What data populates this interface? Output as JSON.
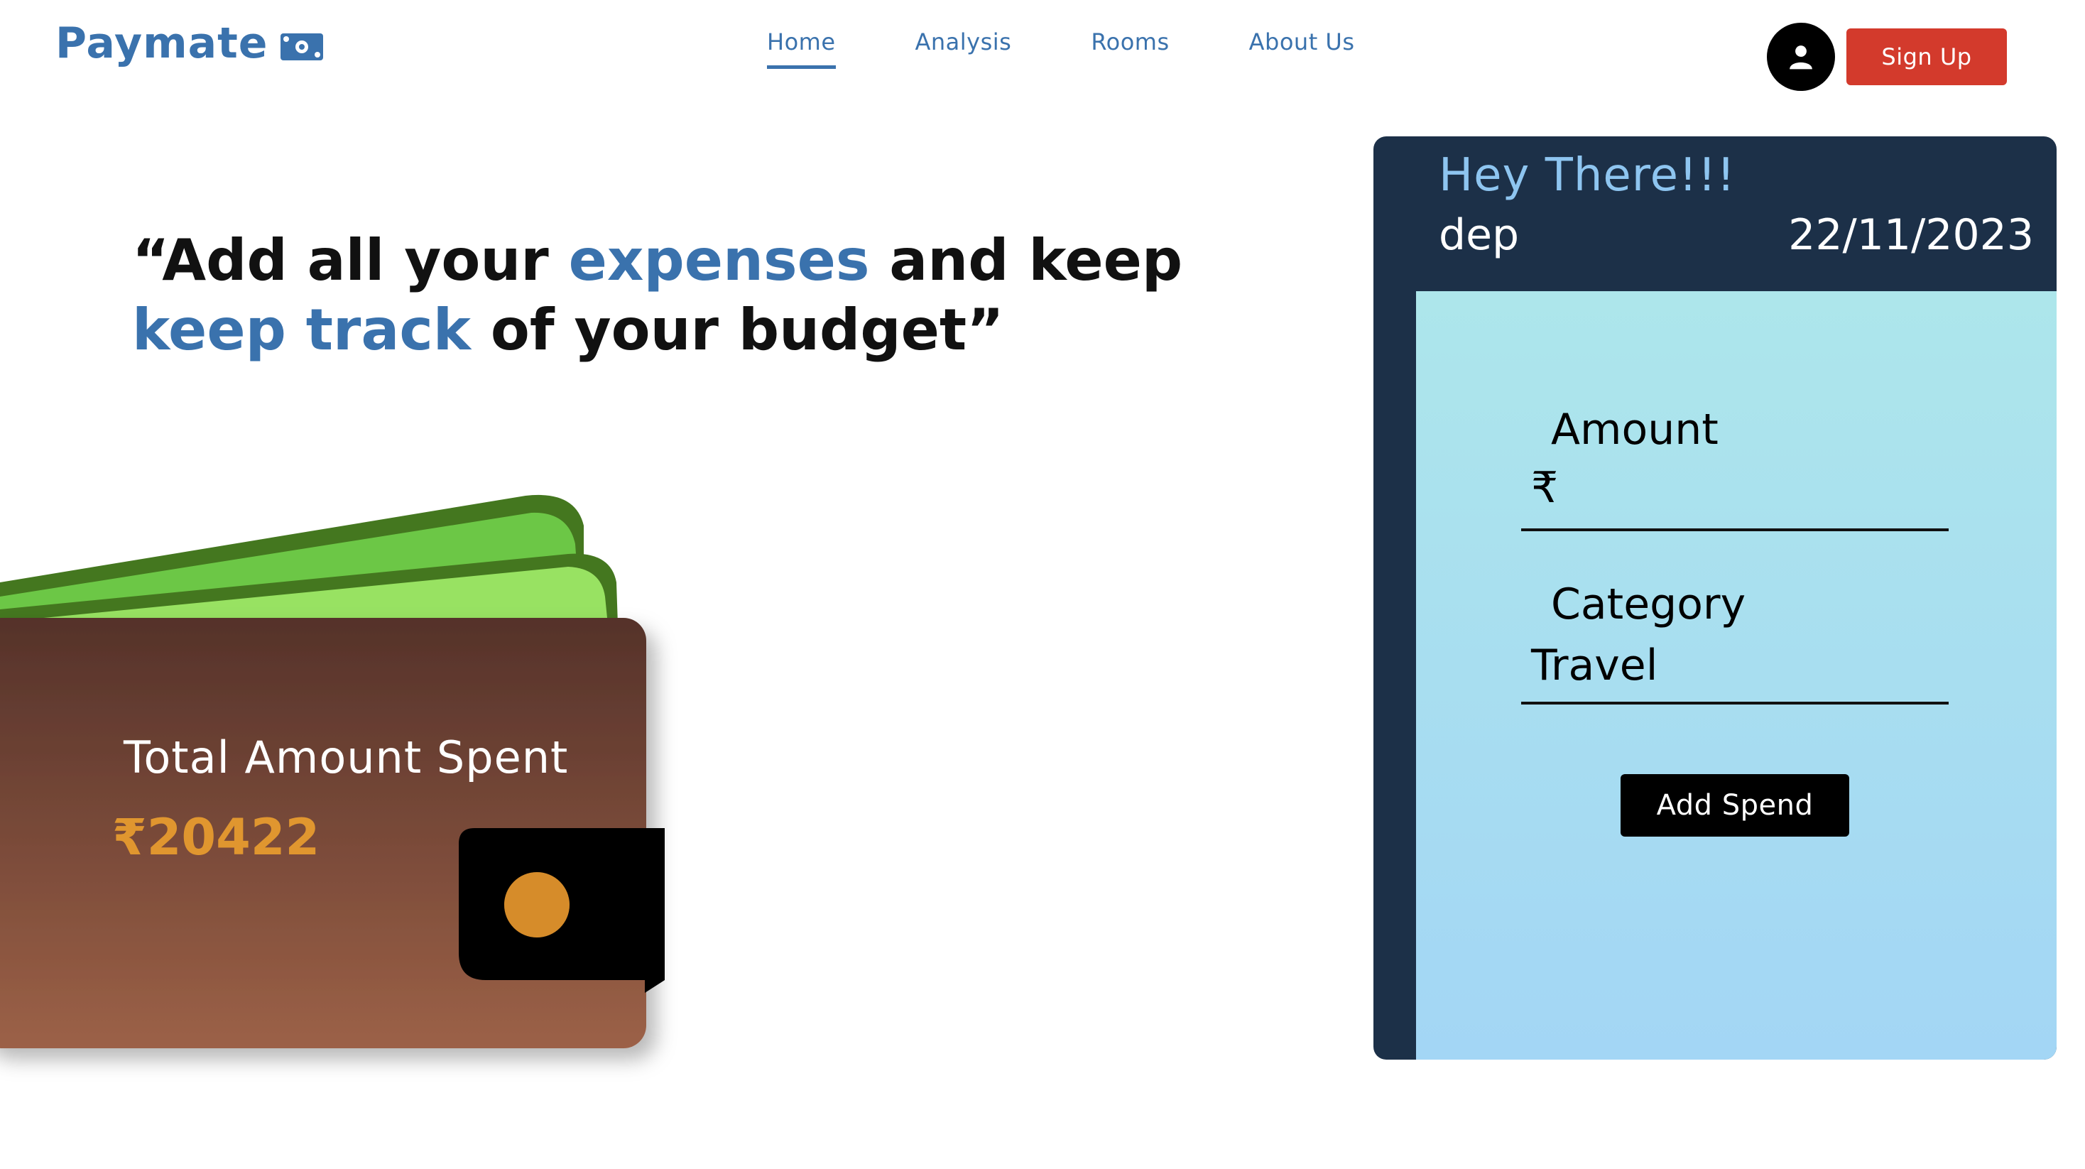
{
  "brand": {
    "name": "Paymate",
    "icon": "money-icon"
  },
  "nav": {
    "items": [
      {
        "label": "Home",
        "active": true
      },
      {
        "label": "Analysis",
        "active": false
      },
      {
        "label": "Rooms",
        "active": false
      },
      {
        "label": "About Us",
        "active": false
      }
    ]
  },
  "header": {
    "avatar_icon": "user-icon",
    "signup_label": "Sign Up"
  },
  "hero": {
    "quote_open": "“Add all your ",
    "quote_hl1": "expenses",
    "quote_mid": " and keep ",
    "quote_hl2": "keep track",
    "quote_end": " of your budget”"
  },
  "wallet": {
    "title": "Total Amount Spent",
    "amount": "₹20422"
  },
  "card": {
    "greeting": "Hey There!!!",
    "user": "dep",
    "date": "22/11/2023",
    "amount_label": "Amount",
    "amount_value": "₹",
    "category_label": "Category",
    "category_value": "Travel",
    "submit_label": "Add Spend"
  },
  "colors": {
    "brand": "#3a72ad",
    "signup": "#d33a2c",
    "card_header": "#1c3048",
    "amount": "#e0962f"
  }
}
